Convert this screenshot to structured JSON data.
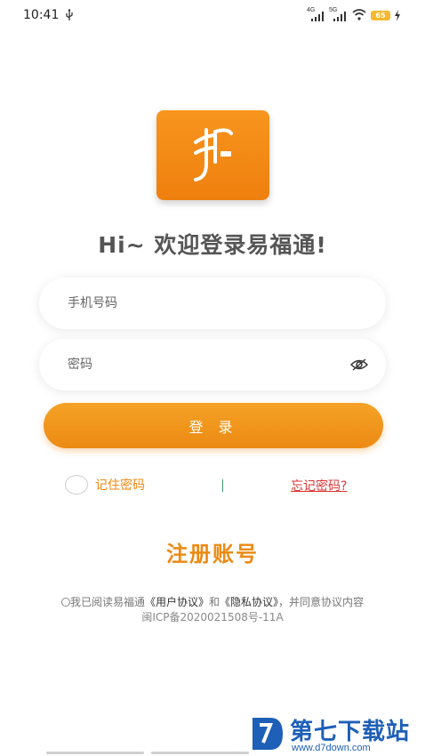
{
  "status_bar": {
    "time": "10:41",
    "signal1_label": "4G",
    "signal2_label": "5G",
    "battery": "65"
  },
  "login": {
    "title": "Hi~ 欢迎登录易福通!",
    "phone_placeholder": "手机号码",
    "password_placeholder": "密码",
    "login_button": "登 录",
    "remember_label": "记住密码",
    "forgot_label": "忘记密码?",
    "register_label": "注册账号"
  },
  "agreement": {
    "prefix": "我已阅读易福通",
    "user_agreement": "《用户协议》",
    "and": "和",
    "privacy_agreement": "《隐私协议》",
    "suffix": "，并同意协议内容",
    "icp": "闽ICP备2020021508号-11A"
  },
  "watermark": {
    "title": "第七下载站",
    "url": "www.d7down.com"
  },
  "colors": {
    "accent": "#ec8a13",
    "forgot": "#dd3333",
    "watermark": "#1e5fb8"
  }
}
